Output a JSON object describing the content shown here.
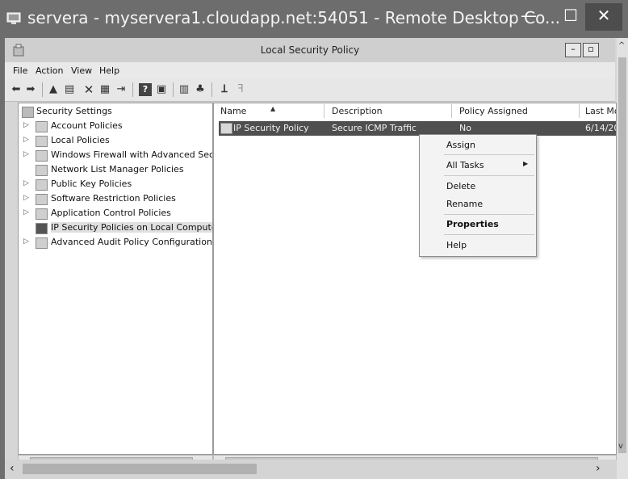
{
  "rdp_window": {
    "title": "servera - myservera1.cloudapp.net:54051 - Remote Desktop Co...",
    "minimize": "—",
    "maximize": "☐",
    "close": "✕"
  },
  "app_window": {
    "title": "Local Security Policy",
    "minimize": "–",
    "maximize": "▫"
  },
  "menu": [
    "File",
    "Action",
    "View",
    "Help"
  ],
  "tree": {
    "root": "Security Settings",
    "items": [
      {
        "label": "Account Policies",
        "expandable": true
      },
      {
        "label": "Local Policies",
        "expandable": true
      },
      {
        "label": "Windows Firewall with Advanced Secu",
        "expandable": true
      },
      {
        "label": "Network List Manager Policies",
        "expandable": false
      },
      {
        "label": "Public Key Policies",
        "expandable": true
      },
      {
        "label": "Software Restriction Policies",
        "expandable": true
      },
      {
        "label": "Application Control Policies",
        "expandable": true
      },
      {
        "label": "IP Security Policies on Local Compute",
        "expandable": false,
        "selected": true
      },
      {
        "label": "Advanced Audit Policy Configuration",
        "expandable": true
      }
    ]
  },
  "list": {
    "columns": [
      "Name",
      "Description",
      "Policy Assigned",
      "Last Mo"
    ],
    "rows": [
      {
        "name": "IP Security Policy",
        "description": "Secure ICMP Traffic",
        "assigned": "No",
        "last_modified": "6/14/20"
      }
    ]
  },
  "context_menu": {
    "items": [
      "Assign",
      "All Tasks",
      "Delete",
      "Rename",
      "Properties",
      "Help"
    ]
  }
}
